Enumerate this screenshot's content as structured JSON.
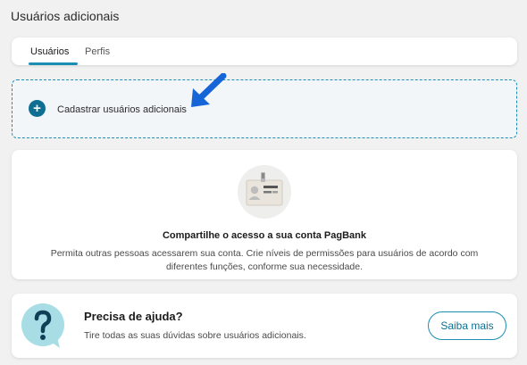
{
  "page": {
    "title": "Usuários adicionais"
  },
  "tabs": [
    {
      "label": "Usuários",
      "active": true
    },
    {
      "label": "Perfis",
      "active": false
    }
  ],
  "add_users": {
    "label": "Cadastrar usuários adicionais",
    "icon": "plus-icon"
  },
  "info_card": {
    "title": "Compartilhe o acesso a sua conta PagBank",
    "description": "Permita outras pessoas acessarem sua conta. Crie níveis de permissões para usuários de acordo com diferentes funções, conforme sua necessidade.",
    "icon": "id-badge-icon"
  },
  "help_card": {
    "title": "Precisa de ajuda?",
    "description": "Tire todas as suas dúvidas sobre usuários adicionais.",
    "button_label": "Saiba mais",
    "icon": "question-bubble-icon"
  },
  "colors": {
    "accent": "#1b8fb3",
    "accent_dark": "#0f6f93",
    "arrow": "#1565d8",
    "background": "#f1f1f1",
    "help_bubble": "#a8dde6"
  }
}
